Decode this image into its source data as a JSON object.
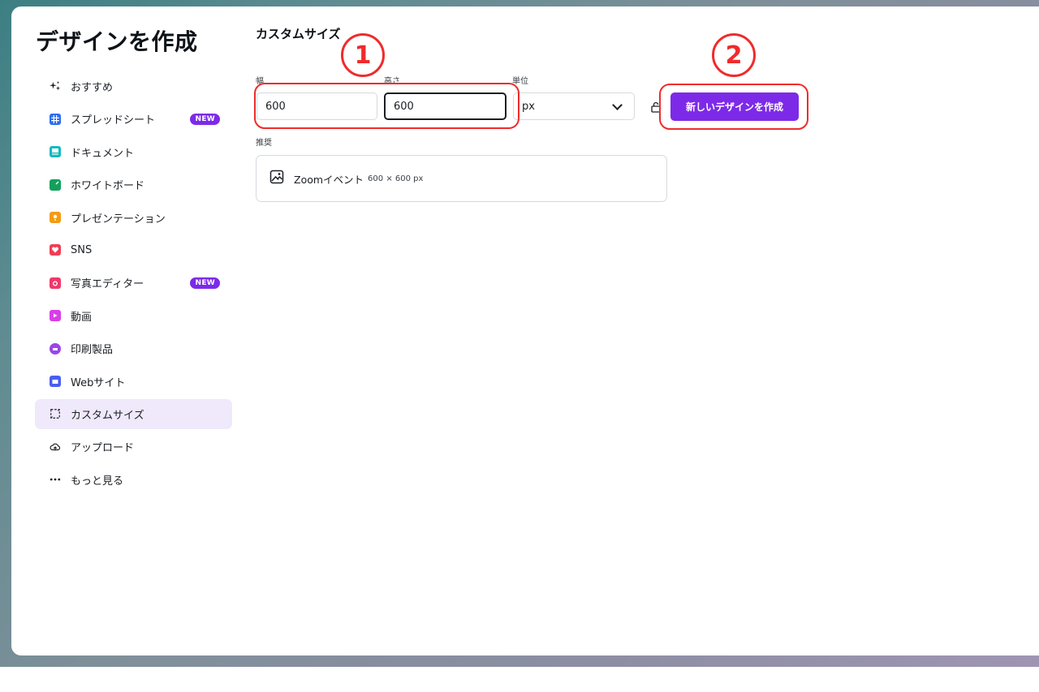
{
  "sidebar": {
    "title": "デザインを作成",
    "items": [
      {
        "label": "おすすめ",
        "icon": "sparkle-icon"
      },
      {
        "label": "スプレッドシート",
        "icon": "spreadsheet-icon",
        "badge": "NEW"
      },
      {
        "label": "ドキュメント",
        "icon": "document-icon"
      },
      {
        "label": "ホワイトボード",
        "icon": "whiteboard-icon"
      },
      {
        "label": "プレゼンテーション",
        "icon": "presentation-icon"
      },
      {
        "label": "SNS",
        "icon": "heart-icon"
      },
      {
        "label": "写真エディター",
        "icon": "camera-icon",
        "badge": "NEW"
      },
      {
        "label": "動画",
        "icon": "video-icon"
      },
      {
        "label": "印刷製品",
        "icon": "printer-icon"
      },
      {
        "label": "Webサイト",
        "icon": "website-icon"
      },
      {
        "label": "カスタムサイズ",
        "icon": "custom-size-icon",
        "active": true
      },
      {
        "label": "アップロード",
        "icon": "upload-cloud-icon"
      },
      {
        "label": "もっと見る",
        "icon": "more-dots-icon"
      }
    ]
  },
  "main": {
    "title": "カスタムサイズ",
    "width_label": "幅",
    "width_value": "600",
    "height_label": "高さ",
    "height_value": "600",
    "unit_label": "単位",
    "unit_value": "px",
    "create_button": "新しいデザインを作成",
    "recommend_label": "推奨",
    "suggestion": {
      "name": "Zoomイベント",
      "size": "600 × 600 px"
    }
  },
  "annotations": {
    "marker1": "1",
    "marker2": "2"
  },
  "colors": {
    "accent": "#7d2ae8",
    "annotation": "#f02b2b",
    "active_bg": "#efe9fb"
  }
}
